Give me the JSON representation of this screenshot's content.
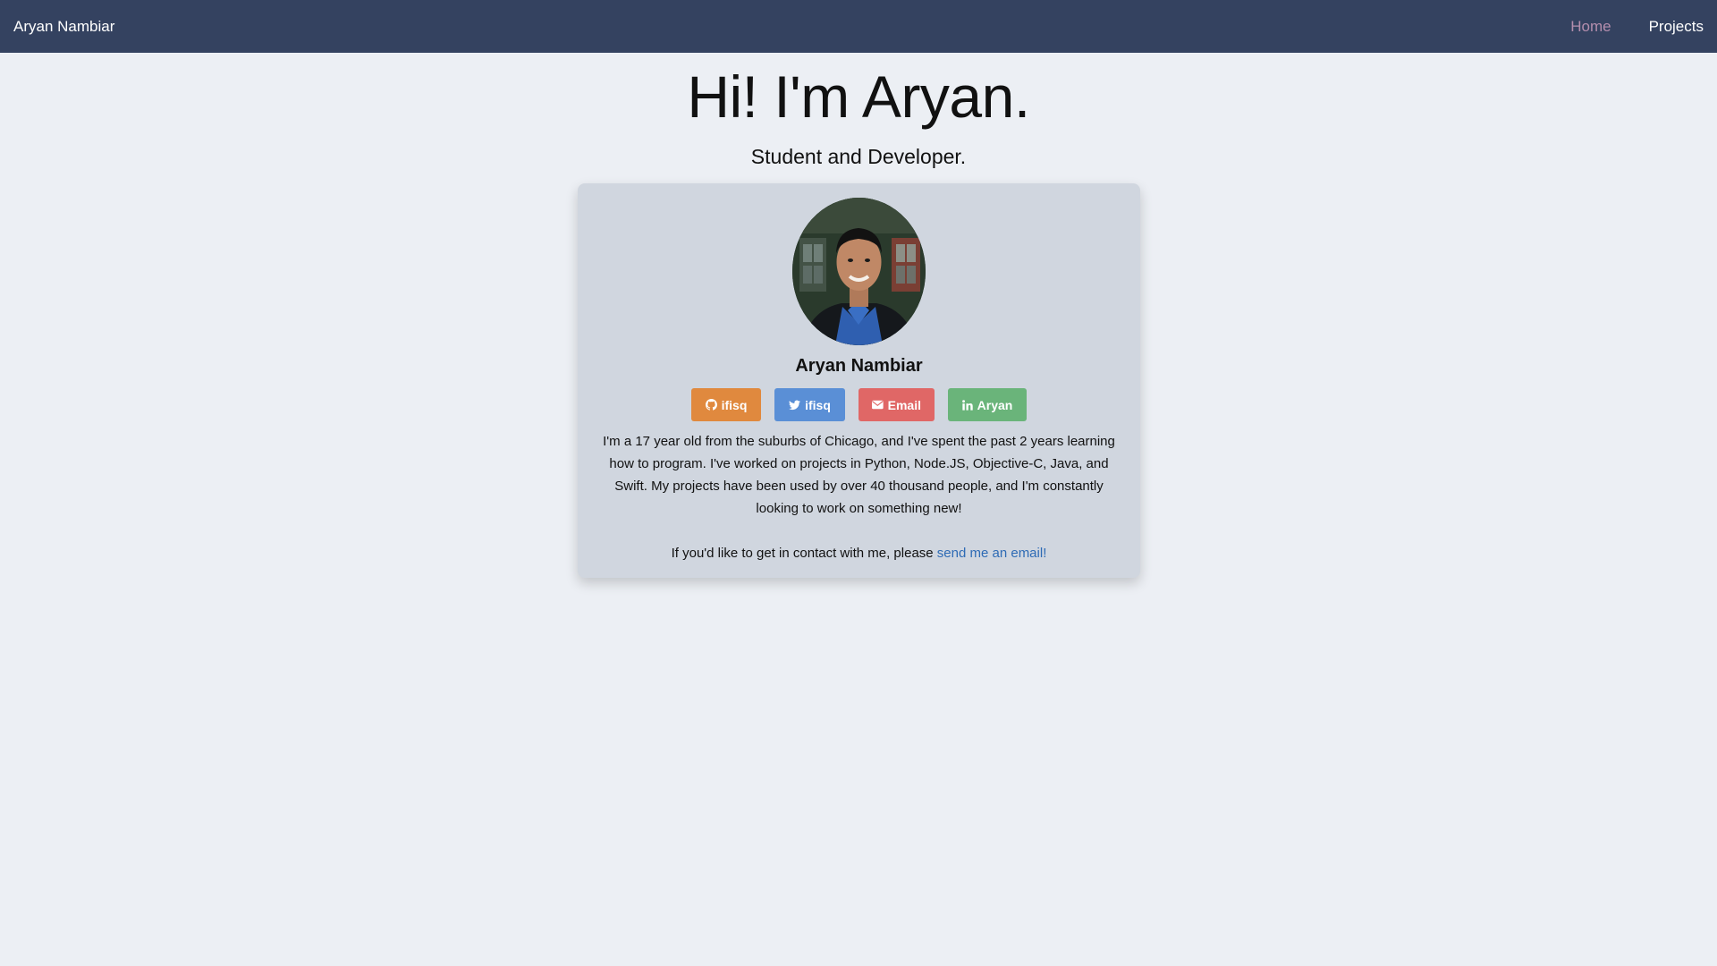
{
  "navbar": {
    "brand": "Aryan Nambiar",
    "links": [
      {
        "label": "Home",
        "active": true
      },
      {
        "label": "Projects",
        "active": false
      }
    ],
    "background": "#344260",
    "active_color": "#b48ead"
  },
  "hero": {
    "title": "Hi! I'm Aryan.",
    "subtitle": "Student and Developer."
  },
  "card": {
    "avatar_icon": "profile-photo",
    "name": "Aryan Nambiar",
    "buttons": [
      {
        "icon": "github-icon",
        "label": "ifisq",
        "color": "#e0893e"
      },
      {
        "icon": "twitter-icon",
        "label": "ifisq",
        "color": "#5a8fd6"
      },
      {
        "icon": "envelope-icon",
        "label": "Email",
        "color": "#e06766"
      },
      {
        "icon": "linkedin-icon",
        "label": "Aryan",
        "color": "#6ab47a"
      }
    ],
    "bio": "I'm a 17 year old from the suburbs of Chicago, and I've spent the past 2 years learning how to program. I've worked on projects in Python, Node.JS, Objective-C, Java, and Swift. My projects have been used by over 40 thousand people, and I'm constantly looking to work on something new!",
    "contact_prefix": "If you'd like to get in contact with me, please ",
    "contact_link": "send me an email!"
  }
}
